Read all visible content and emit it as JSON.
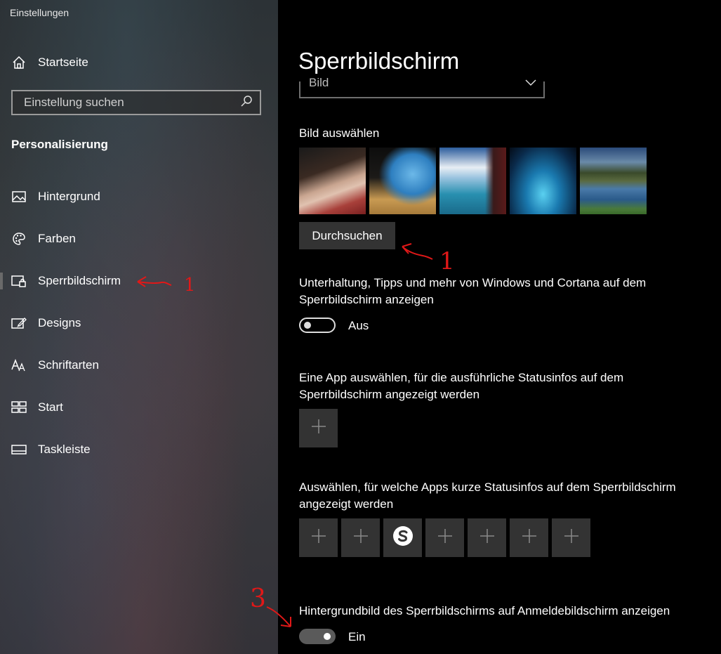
{
  "window": {
    "title": "Einstellungen"
  },
  "sidebar": {
    "home_label": "Startseite",
    "search_placeholder": "Einstellung suchen",
    "section_title": "Personalisierung",
    "items": [
      {
        "label": "Hintergrund",
        "icon": "picture-icon"
      },
      {
        "label": "Farben",
        "icon": "palette-icon"
      },
      {
        "label": "Sperrbildschirm",
        "icon": "lock-screen-icon"
      },
      {
        "label": "Designs",
        "icon": "themes-icon"
      },
      {
        "label": "Schriftarten",
        "icon": "fonts-icon"
      },
      {
        "label": "Start",
        "icon": "start-icon"
      },
      {
        "label": "Taskleiste",
        "icon": "taskbar-icon"
      }
    ]
  },
  "main": {
    "title": "Sperrbildschirm",
    "background_select": {
      "value": "Bild"
    },
    "choose_picture_label": "Bild auswählen",
    "browse_label": "Durchsuchen",
    "tips_toggle": {
      "text_line1": "Unterhaltung, Tipps und mehr von Windows und Cortana auf dem",
      "text_line2": "Sperrbildschirm anzeigen",
      "state_label": "Aus"
    },
    "detailed_status": {
      "text_line1": "Eine App auswählen, für die ausführliche Statusinfos auf dem",
      "text_line2": "Sperrbildschirm angezeigt werden"
    },
    "quick_status": {
      "text_line1": "Auswählen, für welche Apps kurze Statusinfos auf dem Sperrbildschirm",
      "text_line2": "angezeigt werden"
    },
    "signin_background": {
      "text": "Hintergrundbild des Sperrbildschirms auf Anmeldebildschirm anzeigen",
      "state_label": "Ein"
    }
  },
  "annotations": {
    "mark1": "1",
    "mark2": "1",
    "mark3": "3"
  },
  "colors": {
    "accent_annotation": "#e01818",
    "tile_bg": "#333333"
  }
}
